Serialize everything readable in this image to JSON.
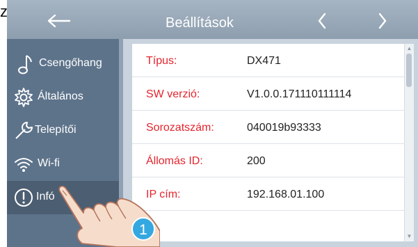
{
  "fragment": "z",
  "header": {
    "title": "Beállítások"
  },
  "sidebar": {
    "items": [
      {
        "label": "Csengőhang",
        "icon": "music-note-icon"
      },
      {
        "label": "Általános",
        "icon": "gear-icon"
      },
      {
        "label": "Telepítői",
        "icon": "wrench-icon"
      },
      {
        "label": "Wi-fi",
        "icon": "wifi-icon"
      },
      {
        "label": "Infó",
        "icon": "info-icon",
        "active": true
      }
    ]
  },
  "info": {
    "rows": [
      {
        "key": "Típus:",
        "value": "DX471"
      },
      {
        "key": "SW verzió:",
        "value": "V1.0.0.171110111114"
      },
      {
        "key": "Sorozatszám:",
        "value": "040019b93333"
      },
      {
        "key": "Állomás ID:",
        "value": "200"
      },
      {
        "key": "IP cím:",
        "value": "192.168.01.100"
      }
    ]
  },
  "overlay": {
    "step": "1",
    "icon": "pointing-hand-icon"
  },
  "colors": {
    "accent_label": "#e4242d",
    "sidebar": "#5d738a",
    "header": "#8d9eaf",
    "step_badge": "#34a8e0"
  }
}
